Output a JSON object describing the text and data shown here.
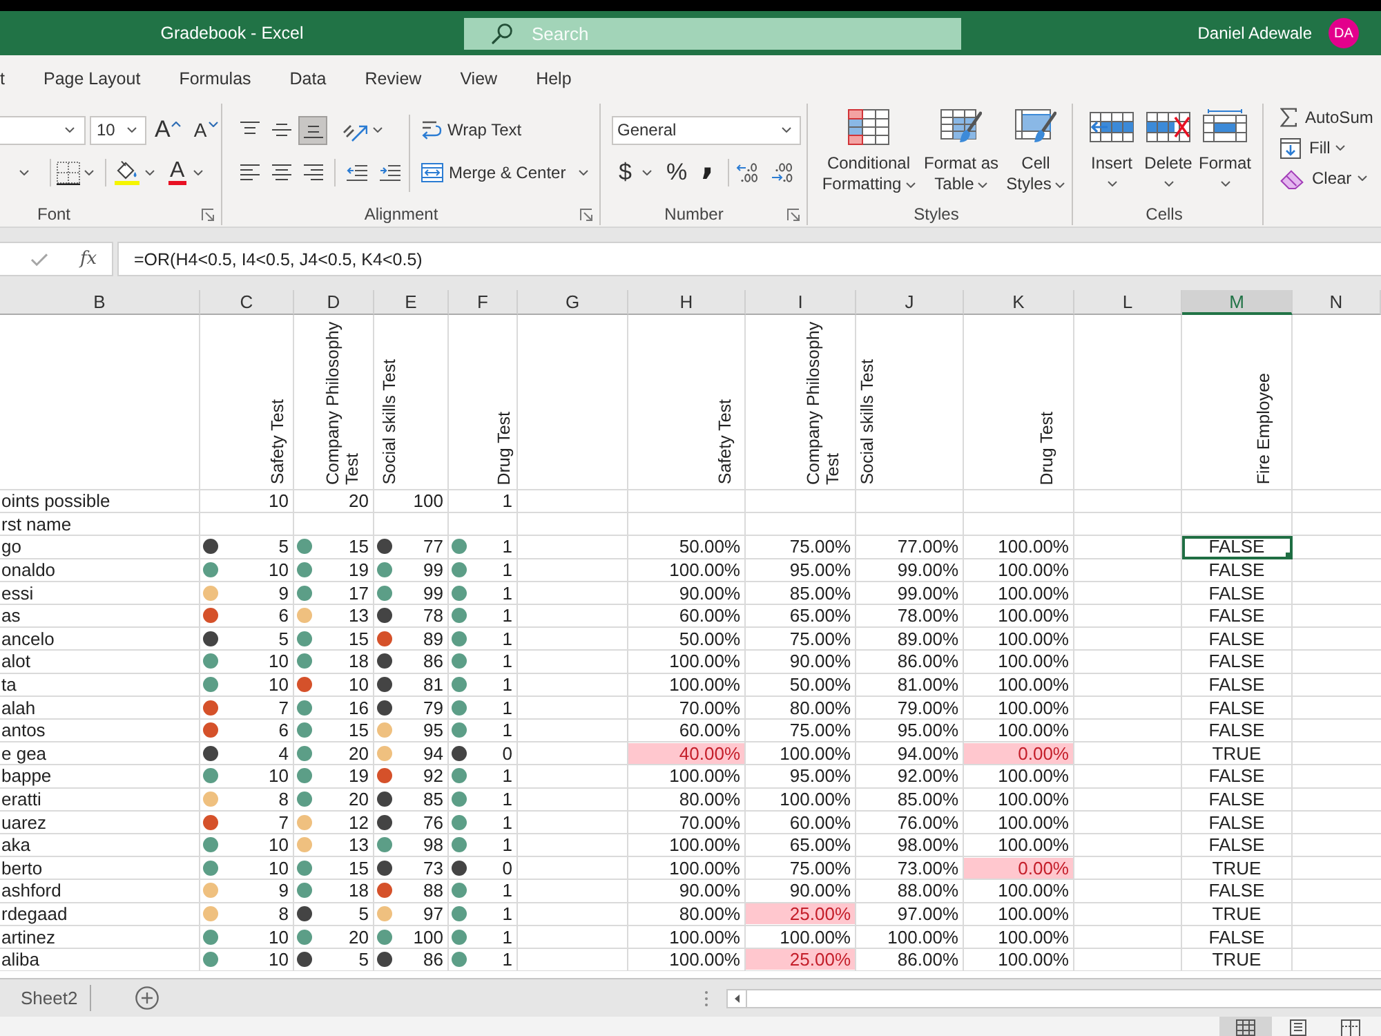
{
  "title_bar": {
    "title": "Gradebook - Excel",
    "search": {
      "placeholder": "Search"
    },
    "user_name": "Daniel Adewale",
    "avatar_initials": "DA"
  },
  "ribbon_tabs": [
    {
      "label": "t",
      "selected": false
    },
    {
      "label": "Page Layout",
      "selected": false
    },
    {
      "label": "Formulas",
      "selected": false
    },
    {
      "label": "Data",
      "selected": false
    },
    {
      "label": "Review",
      "selected": false
    },
    {
      "label": "View",
      "selected": false
    },
    {
      "label": "Help",
      "selected": false
    }
  ],
  "ribbon": {
    "font": {
      "label": "Font",
      "font_size": "10",
      "grow_glyph": "A",
      "shrink_glyph": "A",
      "color_glyph": "A"
    },
    "alignment": {
      "label": "Alignment",
      "vertical_buttons": [
        {
          "kind": "top",
          "selected": false
        },
        {
          "kind": "middle",
          "selected": false
        },
        {
          "kind": "bottom",
          "selected": true
        }
      ],
      "horizontal_buttons": [
        {
          "kind": "left",
          "selected": false
        },
        {
          "kind": "center",
          "selected": false
        },
        {
          "kind": "right",
          "selected": false
        }
      ],
      "wrap_text": "Wrap Text",
      "merge_center": "Merge & Center"
    },
    "number": {
      "label": "Number",
      "format": "General",
      "currency_glyph": "$",
      "percent_glyph": "%",
      "comma_glyph": ","
    },
    "styles": {
      "label": "Styles",
      "buttons": [
        {
          "kind": "conditional",
          "label": "Conditional Formatting"
        },
        {
          "kind": "table",
          "label": "Format as Table"
        },
        {
          "kind": "cell_styles",
          "label": "Cell Styles"
        }
      ]
    },
    "cells": {
      "label": "Cells",
      "buttons": [
        {
          "kind": "insert",
          "label": "Insert"
        },
        {
          "kind": "delete",
          "label": "Delete"
        },
        {
          "kind": "format",
          "label": "Format"
        }
      ]
    },
    "editing": {
      "buttons": [
        {
          "kind": "autosum",
          "label": "AutoSum",
          "dropdown": false
        },
        {
          "kind": "fill",
          "label": "Fill",
          "dropdown": true
        },
        {
          "kind": "clear",
          "label": "Clear",
          "dropdown": true
        }
      ]
    }
  },
  "formula_bar": {
    "function_glyph": "fx",
    "formula": "=OR(H4<0.5, I4<0.5, J4<0.5, K4<0.5)"
  },
  "sheet": {
    "columns": [
      {
        "label": "B",
        "selected": false
      },
      {
        "label": "C",
        "selected": false
      },
      {
        "label": "D",
        "selected": false
      },
      {
        "label": "E",
        "selected": false
      },
      {
        "label": "F",
        "selected": false
      },
      {
        "label": "G",
        "selected": false
      },
      {
        "label": "H",
        "selected": false
      },
      {
        "label": "I",
        "selected": false
      },
      {
        "label": "J",
        "selected": false
      },
      {
        "label": "K",
        "selected": false
      },
      {
        "label": "L",
        "selected": false
      },
      {
        "label": "M",
        "selected": true
      },
      {
        "label": "N",
        "selected": false
      }
    ],
    "headers": {
      "scores": [
        "Safety Test",
        "Company Philosophy Test",
        "Social skills Test",
        "Drug Test"
      ],
      "percents": [
        "Safety Test",
        "Company Philosophy Test",
        "Social skills Test",
        "Drug Test"
      ],
      "fire": "Fire Employee"
    },
    "points_row": {
      "label": "oints possible",
      "values": [
        "10",
        "20",
        "100",
        "1"
      ]
    },
    "name_row": {
      "label": "rst name"
    },
    "rows": [
      {
        "name": "go",
        "scores": [
          {
            "value": "5",
            "color": "#444444"
          },
          {
            "value": "15",
            "color": "#5c9e87"
          },
          {
            "value": "77",
            "color": "#444444"
          },
          {
            "value": "1",
            "color": "#5c9e87"
          }
        ],
        "percents": [
          {
            "value": "50.00%",
            "flagged": false
          },
          {
            "value": "75.00%",
            "flagged": false
          },
          {
            "value": "77.00%",
            "flagged": false
          },
          {
            "value": "100.00%",
            "flagged": false
          }
        ],
        "fire": {
          "value": "FALSE",
          "selected": true
        }
      },
      {
        "name": "onaldo",
        "scores": [
          {
            "value": "10",
            "color": "#5c9e87"
          },
          {
            "value": "19",
            "color": "#5c9e87"
          },
          {
            "value": "99",
            "color": "#5c9e87"
          },
          {
            "value": "1",
            "color": "#5c9e87"
          }
        ],
        "percents": [
          {
            "value": "100.00%",
            "flagged": false
          },
          {
            "value": "95.00%",
            "flagged": false
          },
          {
            "value": "99.00%",
            "flagged": false
          },
          {
            "value": "100.00%",
            "flagged": false
          }
        ],
        "fire": {
          "value": "FALSE",
          "selected": false
        }
      },
      {
        "name": "essi",
        "scores": [
          {
            "value": "9",
            "color": "#efc07f"
          },
          {
            "value": "17",
            "color": "#5c9e87"
          },
          {
            "value": "99",
            "color": "#5c9e87"
          },
          {
            "value": "1",
            "color": "#5c9e87"
          }
        ],
        "percents": [
          {
            "value": "90.00%",
            "flagged": false
          },
          {
            "value": "85.00%",
            "flagged": false
          },
          {
            "value": "99.00%",
            "flagged": false
          },
          {
            "value": "100.00%",
            "flagged": false
          }
        ],
        "fire": {
          "value": "FALSE",
          "selected": false
        }
      },
      {
        "name": "as",
        "scores": [
          {
            "value": "6",
            "color": "#d5512a"
          },
          {
            "value": "13",
            "color": "#efc07f"
          },
          {
            "value": "78",
            "color": "#444444"
          },
          {
            "value": "1",
            "color": "#5c9e87"
          }
        ],
        "percents": [
          {
            "value": "60.00%",
            "flagged": false
          },
          {
            "value": "65.00%",
            "flagged": false
          },
          {
            "value": "78.00%",
            "flagged": false
          },
          {
            "value": "100.00%",
            "flagged": false
          }
        ],
        "fire": {
          "value": "FALSE",
          "selected": false
        }
      },
      {
        "name": "ancelo",
        "scores": [
          {
            "value": "5",
            "color": "#444444"
          },
          {
            "value": "15",
            "color": "#5c9e87"
          },
          {
            "value": "89",
            "color": "#d5512a"
          },
          {
            "value": "1",
            "color": "#5c9e87"
          }
        ],
        "percents": [
          {
            "value": "50.00%",
            "flagged": false
          },
          {
            "value": "75.00%",
            "flagged": false
          },
          {
            "value": "89.00%",
            "flagged": false
          },
          {
            "value": "100.00%",
            "flagged": false
          }
        ],
        "fire": {
          "value": "FALSE",
          "selected": false
        }
      },
      {
        "name": "alot",
        "scores": [
          {
            "value": "10",
            "color": "#5c9e87"
          },
          {
            "value": "18",
            "color": "#5c9e87"
          },
          {
            "value": "86",
            "color": "#444444"
          },
          {
            "value": "1",
            "color": "#5c9e87"
          }
        ],
        "percents": [
          {
            "value": "100.00%",
            "flagged": false
          },
          {
            "value": "90.00%",
            "flagged": false
          },
          {
            "value": "86.00%",
            "flagged": false
          },
          {
            "value": "100.00%",
            "flagged": false
          }
        ],
        "fire": {
          "value": "FALSE",
          "selected": false
        }
      },
      {
        "name": "ta",
        "scores": [
          {
            "value": "10",
            "color": "#5c9e87"
          },
          {
            "value": "10",
            "color": "#d5512a"
          },
          {
            "value": "81",
            "color": "#444444"
          },
          {
            "value": "1",
            "color": "#5c9e87"
          }
        ],
        "percents": [
          {
            "value": "100.00%",
            "flagged": false
          },
          {
            "value": "50.00%",
            "flagged": false
          },
          {
            "value": "81.00%",
            "flagged": false
          },
          {
            "value": "100.00%",
            "flagged": false
          }
        ],
        "fire": {
          "value": "FALSE",
          "selected": false
        }
      },
      {
        "name": "alah",
        "scores": [
          {
            "value": "7",
            "color": "#d5512a"
          },
          {
            "value": "16",
            "color": "#5c9e87"
          },
          {
            "value": "79",
            "color": "#444444"
          },
          {
            "value": "1",
            "color": "#5c9e87"
          }
        ],
        "percents": [
          {
            "value": "70.00%",
            "flagged": false
          },
          {
            "value": "80.00%",
            "flagged": false
          },
          {
            "value": "79.00%",
            "flagged": false
          },
          {
            "value": "100.00%",
            "flagged": false
          }
        ],
        "fire": {
          "value": "FALSE",
          "selected": false
        }
      },
      {
        "name": "antos",
        "scores": [
          {
            "value": "6",
            "color": "#d5512a"
          },
          {
            "value": "15",
            "color": "#5c9e87"
          },
          {
            "value": "95",
            "color": "#efc07f"
          },
          {
            "value": "1",
            "color": "#5c9e87"
          }
        ],
        "percents": [
          {
            "value": "60.00%",
            "flagged": false
          },
          {
            "value": "75.00%",
            "flagged": false
          },
          {
            "value": "95.00%",
            "flagged": false
          },
          {
            "value": "100.00%",
            "flagged": false
          }
        ],
        "fire": {
          "value": "FALSE",
          "selected": false
        }
      },
      {
        "name": "e gea",
        "scores": [
          {
            "value": "4",
            "color": "#444444"
          },
          {
            "value": "20",
            "color": "#5c9e87"
          },
          {
            "value": "94",
            "color": "#efc07f"
          },
          {
            "value": "0",
            "color": "#444444"
          }
        ],
        "percents": [
          {
            "value": "40.00%",
            "flagged": true
          },
          {
            "value": "100.00%",
            "flagged": false
          },
          {
            "value": "94.00%",
            "flagged": false
          },
          {
            "value": "0.00%",
            "flagged": true
          }
        ],
        "fire": {
          "value": "TRUE",
          "selected": false
        }
      },
      {
        "name": "bappe",
        "scores": [
          {
            "value": "10",
            "color": "#5c9e87"
          },
          {
            "value": "19",
            "color": "#5c9e87"
          },
          {
            "value": "92",
            "color": "#d5512a"
          },
          {
            "value": "1",
            "color": "#5c9e87"
          }
        ],
        "percents": [
          {
            "value": "100.00%",
            "flagged": false
          },
          {
            "value": "95.00%",
            "flagged": false
          },
          {
            "value": "92.00%",
            "flagged": false
          },
          {
            "value": "100.00%",
            "flagged": false
          }
        ],
        "fire": {
          "value": "FALSE",
          "selected": false
        }
      },
      {
        "name": "eratti",
        "scores": [
          {
            "value": "8",
            "color": "#efc07f"
          },
          {
            "value": "20",
            "color": "#5c9e87"
          },
          {
            "value": "85",
            "color": "#444444"
          },
          {
            "value": "1",
            "color": "#5c9e87"
          }
        ],
        "percents": [
          {
            "value": "80.00%",
            "flagged": false
          },
          {
            "value": "100.00%",
            "flagged": false
          },
          {
            "value": "85.00%",
            "flagged": false
          },
          {
            "value": "100.00%",
            "flagged": false
          }
        ],
        "fire": {
          "value": "FALSE",
          "selected": false
        }
      },
      {
        "name": "uarez",
        "scores": [
          {
            "value": "7",
            "color": "#d5512a"
          },
          {
            "value": "12",
            "color": "#efc07f"
          },
          {
            "value": "76",
            "color": "#444444"
          },
          {
            "value": "1",
            "color": "#5c9e87"
          }
        ],
        "percents": [
          {
            "value": "70.00%",
            "flagged": false
          },
          {
            "value": "60.00%",
            "flagged": false
          },
          {
            "value": "76.00%",
            "flagged": false
          },
          {
            "value": "100.00%",
            "flagged": false
          }
        ],
        "fire": {
          "value": "FALSE",
          "selected": false
        }
      },
      {
        "name": "aka",
        "scores": [
          {
            "value": "10",
            "color": "#5c9e87"
          },
          {
            "value": "13",
            "color": "#efc07f"
          },
          {
            "value": "98",
            "color": "#5c9e87"
          },
          {
            "value": "1",
            "color": "#5c9e87"
          }
        ],
        "percents": [
          {
            "value": "100.00%",
            "flagged": false
          },
          {
            "value": "65.00%",
            "flagged": false
          },
          {
            "value": "98.00%",
            "flagged": false
          },
          {
            "value": "100.00%",
            "flagged": false
          }
        ],
        "fire": {
          "value": "FALSE",
          "selected": false
        }
      },
      {
        "name": "berto",
        "scores": [
          {
            "value": "10",
            "color": "#5c9e87"
          },
          {
            "value": "15",
            "color": "#5c9e87"
          },
          {
            "value": "73",
            "color": "#444444"
          },
          {
            "value": "0",
            "color": "#444444"
          }
        ],
        "percents": [
          {
            "value": "100.00%",
            "flagged": false
          },
          {
            "value": "75.00%",
            "flagged": false
          },
          {
            "value": "73.00%",
            "flagged": false
          },
          {
            "value": "0.00%",
            "flagged": true
          }
        ],
        "fire": {
          "value": "TRUE",
          "selected": false
        }
      },
      {
        "name": "ashford",
        "scores": [
          {
            "value": "9",
            "color": "#efc07f"
          },
          {
            "value": "18",
            "color": "#5c9e87"
          },
          {
            "value": "88",
            "color": "#d5512a"
          },
          {
            "value": "1",
            "color": "#5c9e87"
          }
        ],
        "percents": [
          {
            "value": "90.00%",
            "flagged": false
          },
          {
            "value": "90.00%",
            "flagged": false
          },
          {
            "value": "88.00%",
            "flagged": false
          },
          {
            "value": "100.00%",
            "flagged": false
          }
        ],
        "fire": {
          "value": "FALSE",
          "selected": false
        }
      },
      {
        "name": "rdegaad",
        "scores": [
          {
            "value": "8",
            "color": "#efc07f"
          },
          {
            "value": "5",
            "color": "#444444"
          },
          {
            "value": "97",
            "color": "#efc07f"
          },
          {
            "value": "1",
            "color": "#5c9e87"
          }
        ],
        "percents": [
          {
            "value": "80.00%",
            "flagged": false
          },
          {
            "value": "25.00%",
            "flagged": true
          },
          {
            "value": "97.00%",
            "flagged": false
          },
          {
            "value": "100.00%",
            "flagged": false
          }
        ],
        "fire": {
          "value": "TRUE",
          "selected": false
        }
      },
      {
        "name": "artinez",
        "scores": [
          {
            "value": "10",
            "color": "#5c9e87"
          },
          {
            "value": "20",
            "color": "#5c9e87"
          },
          {
            "value": "100",
            "color": "#5c9e87"
          },
          {
            "value": "1",
            "color": "#5c9e87"
          }
        ],
        "percents": [
          {
            "value": "100.00%",
            "flagged": false
          },
          {
            "value": "100.00%",
            "flagged": false
          },
          {
            "value": "100.00%",
            "flagged": false
          },
          {
            "value": "100.00%",
            "flagged": false
          }
        ],
        "fire": {
          "value": "FALSE",
          "selected": false
        }
      },
      {
        "name": "aliba",
        "scores": [
          {
            "value": "10",
            "color": "#5c9e87"
          },
          {
            "value": "5",
            "color": "#444444"
          },
          {
            "value": "86",
            "color": "#444444"
          },
          {
            "value": "1",
            "color": "#5c9e87"
          }
        ],
        "percents": [
          {
            "value": "100.00%",
            "flagged": false
          },
          {
            "value": "25.00%",
            "flagged": true
          },
          {
            "value": "86.00%",
            "flagged": false
          },
          {
            "value": "100.00%",
            "flagged": false
          }
        ],
        "fire": {
          "value": "TRUE",
          "selected": false
        }
      }
    ]
  },
  "sheet_tabs": [
    {
      "label": "Sheet2",
      "selected": false
    }
  ],
  "status_bar": {
    "views": [
      {
        "kind": "normal",
        "selected": true
      },
      {
        "kind": "page_layout",
        "selected": false
      },
      {
        "kind": "page_break",
        "selected": false
      }
    ]
  }
}
